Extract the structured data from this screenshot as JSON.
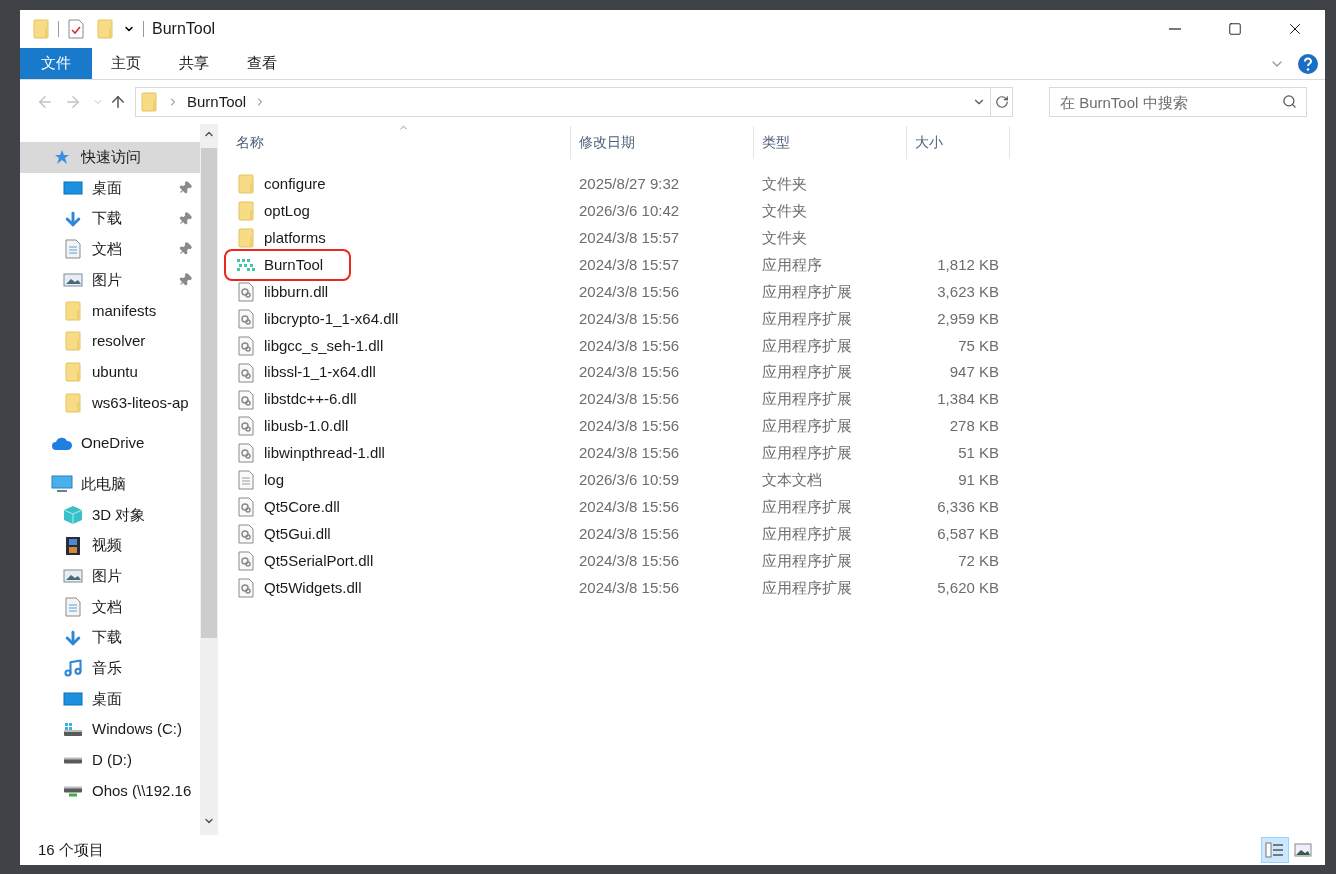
{
  "window": {
    "title": "BurnTool"
  },
  "ribbon": {
    "tabs": [
      {
        "label": "文件",
        "selected": true
      },
      {
        "label": "主页",
        "selected": false
      },
      {
        "label": "共享",
        "selected": false
      },
      {
        "label": "查看",
        "selected": false
      }
    ]
  },
  "address": {
    "path": [
      "BurnTool"
    ]
  },
  "search": {
    "placeholder": "在 BurnTool 中搜索"
  },
  "sidebar": {
    "items": [
      {
        "label": "快速访问",
        "kind": "star",
        "selected": true,
        "children": [
          {
            "label": "桌面",
            "kind": "desktop",
            "pinned": true
          },
          {
            "label": "下载",
            "kind": "download",
            "pinned": true
          },
          {
            "label": "文档",
            "kind": "document",
            "pinned": true
          },
          {
            "label": "图片",
            "kind": "pictures",
            "pinned": true
          },
          {
            "label": "manifests",
            "kind": "folder",
            "pinned": false
          },
          {
            "label": "resolver",
            "kind": "folder",
            "pinned": false
          },
          {
            "label": "ubuntu",
            "kind": "folder",
            "pinned": false
          },
          {
            "label": "ws63-liteos-ap",
            "kind": "folder",
            "pinned": false
          }
        ]
      },
      {
        "label": "OneDrive",
        "kind": "cloud",
        "selected": false
      },
      {
        "label": "此电脑",
        "kind": "pc",
        "selected": false,
        "children": [
          {
            "label": "3D 对象",
            "kind": "cube",
            "pinned": false
          },
          {
            "label": "视频",
            "kind": "video",
            "pinned": false
          },
          {
            "label": "图片",
            "kind": "pictures",
            "pinned": false
          },
          {
            "label": "文档",
            "kind": "document",
            "pinned": false
          },
          {
            "label": "下载",
            "kind": "download",
            "pinned": false
          },
          {
            "label": "音乐",
            "kind": "music",
            "pinned": false
          },
          {
            "label": "桌面",
            "kind": "desktop",
            "pinned": false
          },
          {
            "label": "Windows (C:)",
            "kind": "windrive",
            "pinned": false
          },
          {
            "label": "D (D:)",
            "kind": "drive",
            "pinned": false
          },
          {
            "label": "Ohos (\\\\192.16",
            "kind": "netdrive",
            "pinned": false
          }
        ]
      }
    ]
  },
  "table": {
    "columns": [
      "名称",
      "修改日期",
      "类型",
      "大小"
    ],
    "rows": [
      {
        "kind": "folder",
        "name": "configure",
        "date": "2025/8/27 9:32",
        "type": "文件夹",
        "highlighted": false
      },
      {
        "kind": "folder",
        "name": "optLog",
        "date": "2026/3/6 10:42",
        "type": "文件夹",
        "highlighted": false
      },
      {
        "kind": "folder",
        "name": "platforms",
        "date": "2024/3/8 15:57",
        "type": "文件夹",
        "highlighted": false
      },
      {
        "kind": "app",
        "name": "BurnTool",
        "date": "2024/3/8 15:57",
        "type": "应用程序",
        "size": "1,812 KB",
        "highlighted": true
      },
      {
        "kind": "dll",
        "name": "libburn.dll",
        "date": "2024/3/8 15:56",
        "type": "应用程序扩展",
        "size": "3,623 KB",
        "highlighted": false
      },
      {
        "kind": "dll",
        "name": "libcrypto-1_1-x64.dll",
        "date": "2024/3/8 15:56",
        "type": "应用程序扩展",
        "size": "2,959 KB",
        "highlighted": false
      },
      {
        "kind": "dll",
        "name": "libgcc_s_seh-1.dll",
        "date": "2024/3/8 15:56",
        "type": "应用程序扩展",
        "size": "75 KB",
        "highlighted": false
      },
      {
        "kind": "dll",
        "name": "libssl-1_1-x64.dll",
        "date": "2024/3/8 15:56",
        "type": "应用程序扩展",
        "size": "947 KB",
        "highlighted": false
      },
      {
        "kind": "dll",
        "name": "libstdc++-6.dll",
        "date": "2024/3/8 15:56",
        "type": "应用程序扩展",
        "size": "1,384 KB",
        "highlighted": false
      },
      {
        "kind": "dll",
        "name": "libusb-1.0.dll",
        "date": "2024/3/8 15:56",
        "type": "应用程序扩展",
        "size": "278 KB",
        "highlighted": false
      },
      {
        "kind": "dll",
        "name": "libwinpthread-1.dll",
        "date": "2024/3/8 15:56",
        "type": "应用程序扩展",
        "size": "51 KB",
        "highlighted": false
      },
      {
        "kind": "text",
        "name": "log",
        "date": "2026/3/6 10:59",
        "type": "文本文档",
        "size": "91 KB",
        "highlighted": false
      },
      {
        "kind": "dll",
        "name": "Qt5Core.dll",
        "date": "2024/3/8 15:56",
        "type": "应用程序扩展",
        "size": "6,336 KB",
        "highlighted": false
      },
      {
        "kind": "dll",
        "name": "Qt5Gui.dll",
        "date": "2024/3/8 15:56",
        "type": "应用程序扩展",
        "size": "6,587 KB",
        "highlighted": false
      },
      {
        "kind": "dll",
        "name": "Qt5SerialPort.dll",
        "date": "2024/3/8 15:56",
        "type": "应用程序扩展",
        "size": "72 KB",
        "highlighted": false
      },
      {
        "kind": "dll",
        "name": "Qt5Widgets.dll",
        "date": "2024/3/8 15:56",
        "type": "应用程序扩展",
        "size": "5,620 KB",
        "highlighted": false
      }
    ]
  },
  "status_bar": {
    "count": "16 个项目"
  },
  "view_buttons": [
    {
      "kind": "details",
      "selected": true
    },
    {
      "kind": "thumbnails",
      "selected": false
    }
  ]
}
